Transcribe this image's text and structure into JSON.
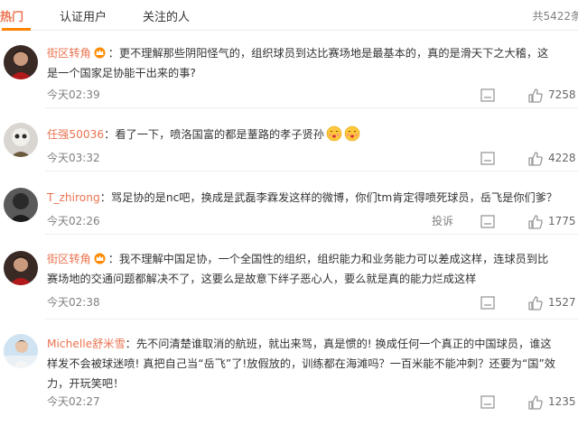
{
  "tabs": [
    {
      "label": "热门",
      "active": true
    },
    {
      "label": "认证用户",
      "active": false
    },
    {
      "label": "关注的人",
      "active": false
    }
  ],
  "total_label": "共5422条",
  "colors": {
    "accent": "#eb7350",
    "tab_underline": "#ff8200",
    "meta": "#808080"
  },
  "comments": [
    {
      "username": "街区转角",
      "vip_badge": "vip-crown-icon",
      "line1": "：更不理解那些阴阳怪气的，组织球员到达比赛场地是最基本的，真的是滑天下之大稽，这",
      "line2": "是一个国家足协能干出来的事?",
      "time": "今天02:39",
      "likes": "7258"
    },
    {
      "username": "任强50036",
      "text": "：看了一下，喷洛国富的都是蕫路的孝子贤孙",
      "emojis": [
        "kiss-face-icon",
        "kiss-face-icon"
      ],
      "time": "今天03:32",
      "likes": "4228"
    },
    {
      "username": "T_zhirong",
      "text": "：骂足协的是nc吧，换成是武磊李霖发这样的微博，你们tm肯定得喷死球员，岳飞是你们爹？",
      "time": "今天02:26",
      "report": "投诉",
      "likes": "1775"
    },
    {
      "username": "街区转角",
      "vip_badge": "vip-crown-icon",
      "line1": "：我不理解中国足协，一个全国性的组织，组织能力和业务能力可以差成这样，连球员到比",
      "line2": "赛场地的交通问题都解决不了，这要么是故意下绊子恶心人，要么就是真的能力烂成这样",
      "time": "今天02:38",
      "likes": "1527"
    },
    {
      "username": "Michelle舒米雪",
      "line1": "：先不问清楚谁取消的航班，就出来骂，真是惯的! 换成任何一个真正的中国球员，谁这",
      "line2": "样发不会被球迷喷! 真把自己当“岳飞”了!放假放的，训练都在海滩吗？一百米能不能冲刺？还要为“国”效",
      "line3": "力，开玩笑吧！",
      "time": "今天02:27",
      "likes": "1235"
    }
  ]
}
